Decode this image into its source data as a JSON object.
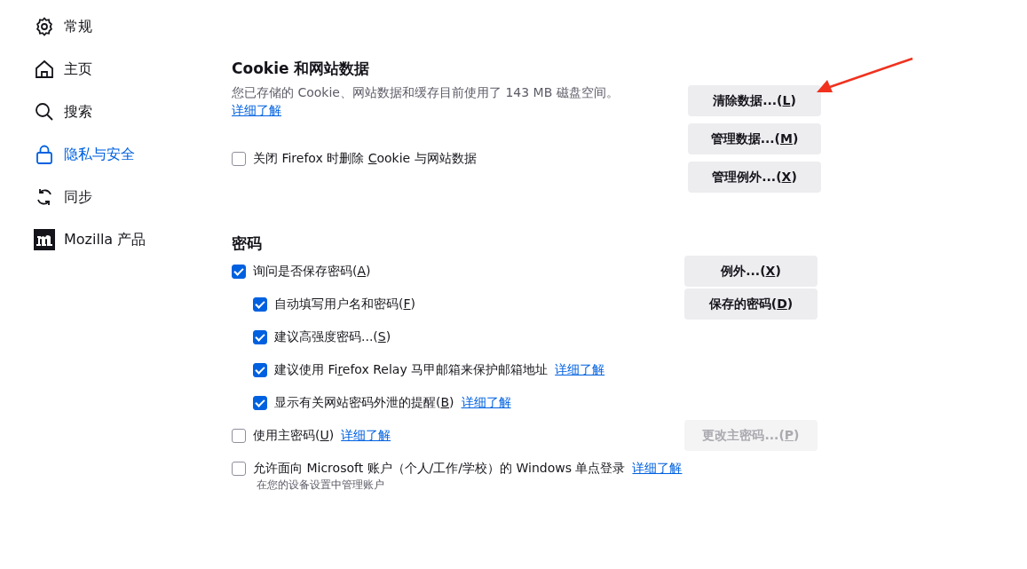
{
  "sidebar": {
    "items": [
      {
        "label": "常规",
        "selected": false
      },
      {
        "label": "主页",
        "selected": false
      },
      {
        "label": "搜索",
        "selected": false
      },
      {
        "label": "隐私与安全",
        "selected": true
      },
      {
        "label": "同步",
        "selected": false
      },
      {
        "label": "Mozilla 产品",
        "selected": false
      }
    ]
  },
  "cookies": {
    "title": "Cookie 和网站数据",
    "description": "您已存储的 Cookie、网站数据和缓存目前使用了 143 MB 磁盘空间。",
    "link": "详细了解",
    "checkbox": {
      "label": {
        "before": "关闭 Firefox 时删除 ",
        "key": "C",
        "after": "ookie 与网站数据"
      },
      "checked": false
    },
    "buttons": [
      {
        "label": {
          "before": "清除数据...(",
          "key": "L",
          "after": ")"
        },
        "disabled": false
      },
      {
        "label": {
          "before": "管理数据...(",
          "key": "M",
          "after": ")"
        },
        "disabled": false
      },
      {
        "label": {
          "before": "管理例外...(",
          "key": "X",
          "after": ")"
        },
        "disabled": false
      }
    ]
  },
  "passwords": {
    "title": "密码",
    "options": [
      {
        "label": {
          "before": "询问是否保存密码(",
          "key": "A",
          "after": ")"
        },
        "checked": true,
        "button": {
          "label": {
            "before": "例外...(",
            "key": "X",
            "after": ")"
          },
          "disabled": false
        },
        "children": [
          {
            "label": {
              "before": "自动填写用户名和密码(",
              "key": "F",
              "after": ")"
            },
            "checked": true,
            "button": {
              "label": {
                "before": "保存的密码(",
                "key": "D",
                "after": ")"
              },
              "disabled": false
            }
          },
          {
            "label": {
              "before": "建议高强度密码...(",
              "key": "S",
              "after": ")"
            },
            "checked": true
          },
          {
            "label": {
              "before": "建议使用 Fi",
              "key": "r",
              "after": "efox Relay 马甲邮箱来保护邮箱地址"
            },
            "checked": true,
            "link": "详细了解"
          },
          {
            "label": {
              "before": "显示有关网站密码外泄的提醒(",
              "key": "B",
              "after": ")"
            },
            "checked": true,
            "link": "详细了解"
          }
        ]
      },
      {
        "label": {
          "before": "使用主密码(",
          "key": "U",
          "after": ")"
        },
        "checked": false,
        "link": "详细了解",
        "button": {
          "label": {
            "before": "更改主密码...(",
            "key": "P",
            "after": ")"
          },
          "disabled": true
        }
      },
      {
        "label": {
          "before": "允许面向 Microsoft 账户（个人/工作/学校）的 Windows 单点登录"
        },
        "checked": false,
        "link": "详细了解",
        "note": "在您的设备设置中管理账户"
      }
    ]
  },
  "annotation": {
    "kind": "arrow"
  }
}
